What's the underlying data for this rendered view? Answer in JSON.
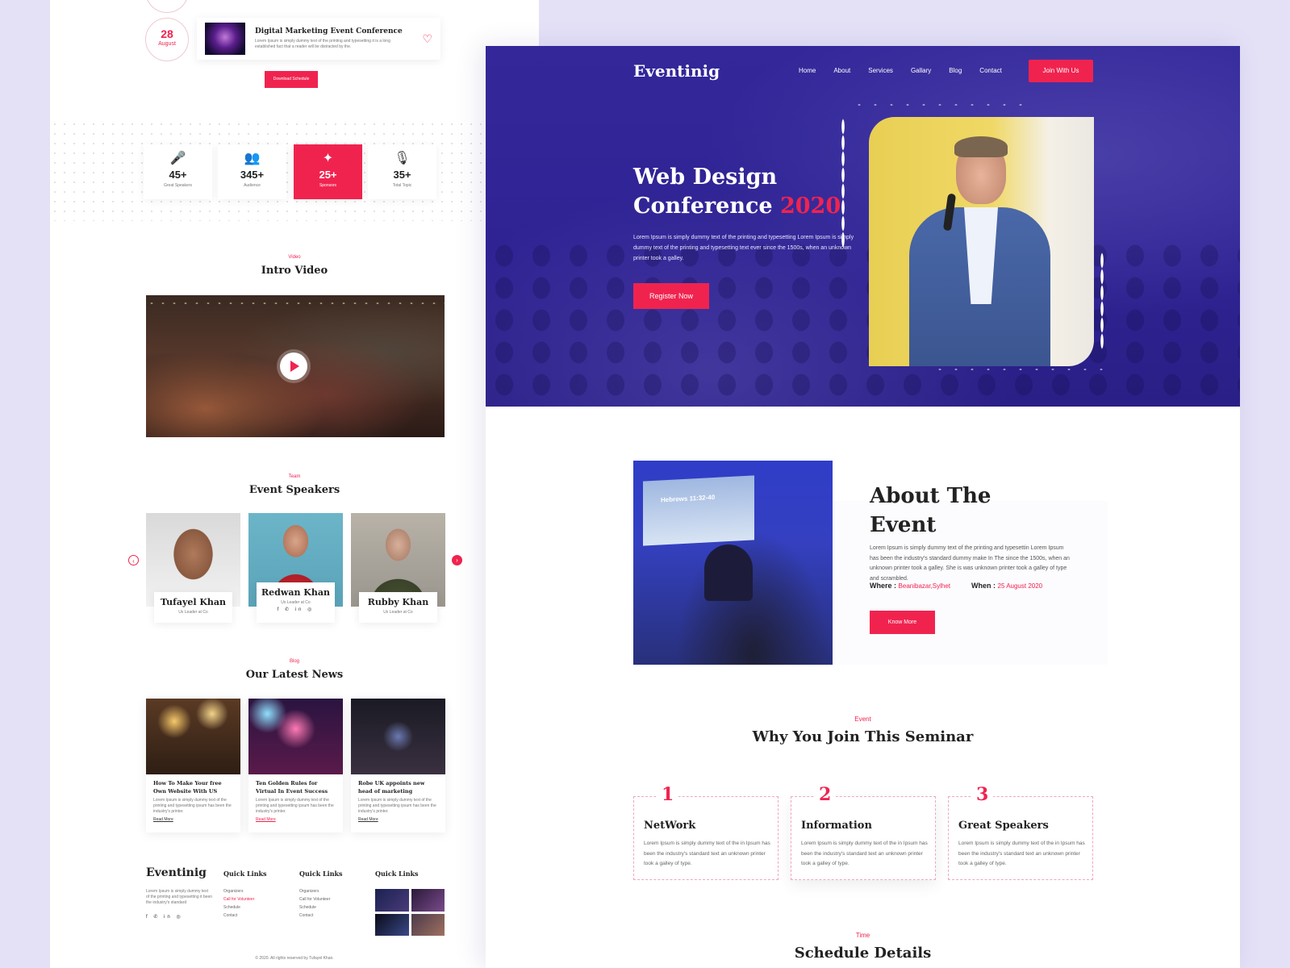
{
  "left": {
    "schedule": {
      "date_day": "28",
      "date_month": "August",
      "event_title": "Digital Marketing Event Conference",
      "event_desc": "Lorem Ipsum is simply dummy text of the printing and typesetting it is a long established fact that a reader will be distracted by the.",
      "download_label": "Download Schedule"
    },
    "stats": [
      {
        "value": "45+",
        "label": "Great Speakers",
        "icon": "microphones-icon"
      },
      {
        "value": "345+",
        "label": "Audience",
        "icon": "audience-icon"
      },
      {
        "value": "25+",
        "label": "Sponsors",
        "icon": "sponsor-icon",
        "active": true
      },
      {
        "value": "35+",
        "label": "Total Topic",
        "icon": "mic-icon"
      }
    ],
    "video": {
      "tag": "Video",
      "title": "Intro Video"
    },
    "speakers": {
      "tag": "Team",
      "title": "Event Speakers",
      "items": [
        {
          "name": "Tufayel Khan",
          "role": "Ux Leader at Co"
        },
        {
          "name": "Redwan Khan",
          "role": "Ux Leader at Co"
        },
        {
          "name": "Rubby Khan",
          "role": "Ux Leader at Co"
        }
      ]
    },
    "news": {
      "tag": "Blog",
      "title": "Our Latest News",
      "items": [
        {
          "title": "How To Make Your free Own Website With US",
          "desc": "Lorem Ipsum is simply dummy text of the printing and typesetting ipsum has been the industry's printer.",
          "more": "Read More"
        },
        {
          "title": "Ten Golden Rules for Virtual In Event Success",
          "desc": "Lorem Ipsum is simply dummy text of the printing and typesetting ipsum has been the industry's printer.",
          "more": "Read More"
        },
        {
          "title": "Robe UK appoints new head of marketing",
          "desc": "Lorem Ipsum is simply dummy text of the printing and typesetting ipsum has been the industry's printer.",
          "more": "Read More"
        }
      ]
    },
    "footer": {
      "brand": "Eventinig",
      "about": "Lorem Ipsum is simply dummy text of the printing and typesetting it been the industry's standard",
      "col1": {
        "title": "Quick Links",
        "items": [
          "Organizers",
          "Call for Volunteer",
          "Schedule",
          "Contact"
        ]
      },
      "col2": {
        "title": "Quick Links",
        "items": [
          "Organizers",
          "Call for Volunteer",
          "Schedule",
          "Contact"
        ]
      },
      "col3": {
        "title": "Quick Links"
      },
      "copyright": "© 2020. All rights reserved by Tufayel Khan."
    }
  },
  "hero": {
    "brand": "Eventinig",
    "nav": [
      "Home",
      "About",
      "Services",
      "Gallary",
      "Blog",
      "Contact"
    ],
    "join_label": "Join With Us",
    "title_line1": "Web Design",
    "title_line2": "Conference",
    "title_year": "2020",
    "desc": "Lorem Ipsum is simply dummy text of the printing and typesetting Lorem Ipsum is simply dummy text of the printing and typesetting text ever since the 1500s, when an unknown printer took a galley.",
    "register_label": "Register Now"
  },
  "about": {
    "screen_text": "Hebrews 11:32-40",
    "title_line1": "About The",
    "title_line2": "Event",
    "desc": "Lorem Ipsum is simply dummy text of the printing and typesettin Lorem Ipsum has been the industry's standard dummy make In The since the 1500s, when an unknown printer took a galley. She is was unknown printer took a galley of type and scrambled.",
    "where_label": "Where :",
    "where_value": "Beanibazar,Sylhet",
    "when_label": "When :",
    "when_value": "25 August 2020",
    "button_label": "Know More"
  },
  "why": {
    "tag": "Event",
    "title": "Why You Join This Seminar",
    "items": [
      {
        "num": "1",
        "title": "NetWork",
        "desc": "Lorem Ipsum is simply dummy text of the in Ipsum has been the industry's standard text an unknown printer took a galley of type."
      },
      {
        "num": "2",
        "title": "Information",
        "desc": "Lorem Ipsum is simply dummy text of the in Ipsum has been the industry's standard text an unknown printer took a galley of type."
      },
      {
        "num": "3",
        "title": "Great Speakers",
        "desc": "Lorem Ipsum is simply dummy text of the in Ipsum has been the industry's standard text an unknown printer took a galley of type."
      }
    ]
  },
  "schedule": {
    "tag": "Time",
    "title": "Schedule Details"
  },
  "colors": {
    "accent": "#f0234f",
    "hero_bg": "#2f2394",
    "page_bg": "#e4e1f7"
  }
}
